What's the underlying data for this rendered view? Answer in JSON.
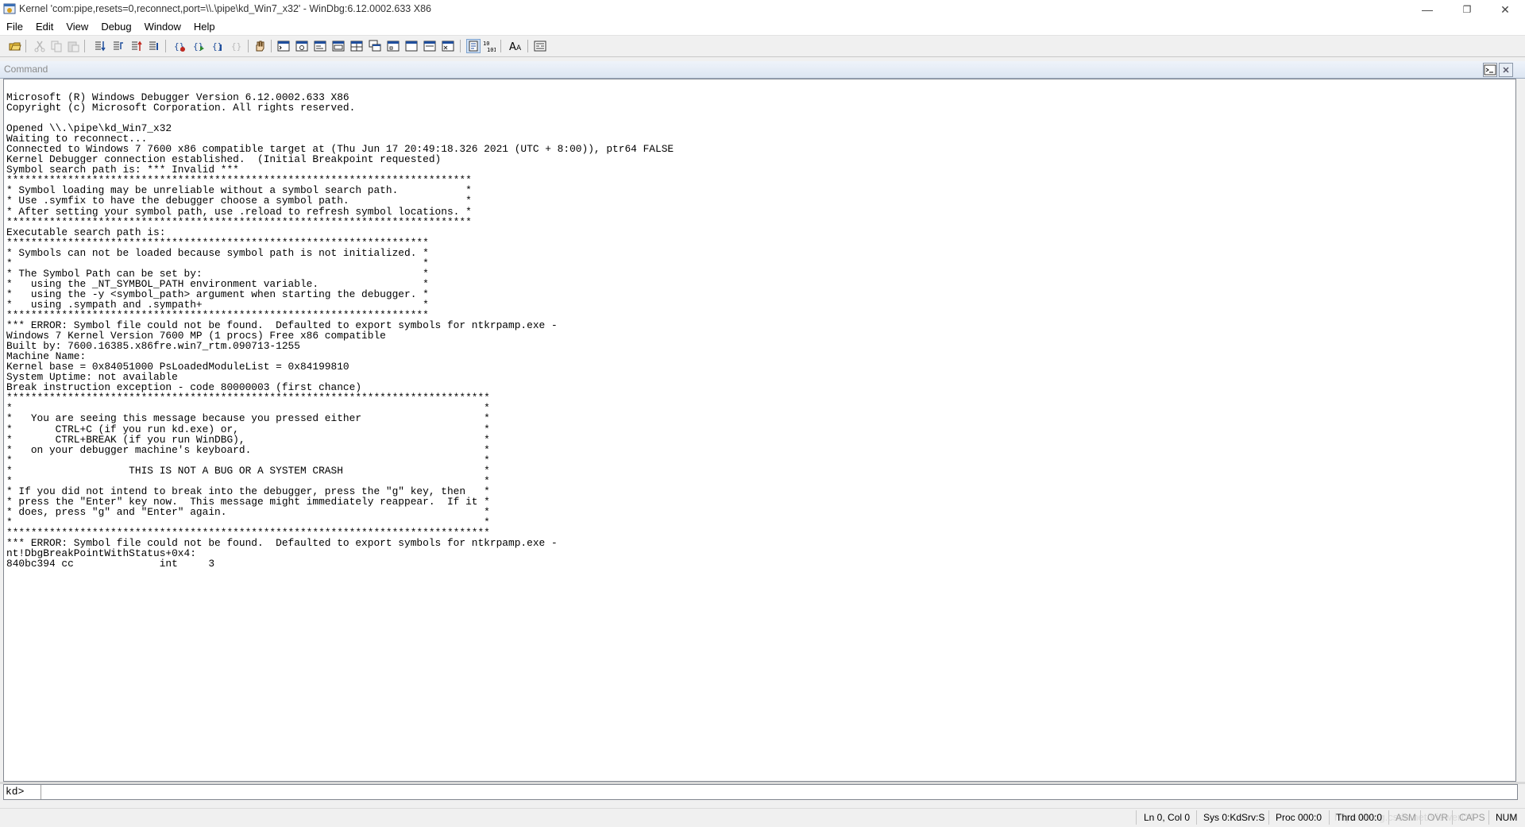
{
  "window": {
    "title": "Kernel 'com:pipe,resets=0,reconnect,port=\\\\.\\pipe\\kd_Win7_x32' - WinDbg:6.12.0002.633 X86",
    "controls": {
      "minimize": "—",
      "restore": "❐",
      "close": "✕"
    }
  },
  "menu": [
    "File",
    "Edit",
    "View",
    "Debug",
    "Window",
    "Help"
  ],
  "toolbar": {
    "icons": [
      "open-icon",
      "cut-icon",
      "copy-icon",
      "paste-icon",
      "step-into-icon",
      "step-over-icon",
      "step-out-icon",
      "run-to-cursor-icon",
      "toggle-breakpoint-icon",
      "go-icon",
      "break-icon",
      "restart-icon",
      "hand-icon",
      "command-window-icon",
      "watch-window-icon",
      "locals-window-icon",
      "registers-window-icon",
      "memory-window-icon",
      "call-stack-icon",
      "disassembly-icon",
      "scratch-pad-icon",
      "processes-threads-icon",
      "source-mode-icon",
      "hex-mode-icon",
      "font-icon",
      "options-icon"
    ]
  },
  "command_window": {
    "title": "Command",
    "output": "Microsoft (R) Windows Debugger Version 6.12.0002.633 X86\nCopyright (c) Microsoft Corporation. All rights reserved.\n\nOpened \\\\.\\pipe\\kd_Win7_x32\nWaiting to reconnect...\nConnected to Windows 7 7600 x86 compatible target at (Thu Jun 17 20:49:18.326 2021 (UTC + 8:00)), ptr64 FALSE\nKernel Debugger connection established.  (Initial Breakpoint requested)\nSymbol search path is: *** Invalid ***\n****************************************************************************\n* Symbol loading may be unreliable without a symbol search path.           *\n* Use .symfix to have the debugger choose a symbol path.                   *\n* After setting your symbol path, use .reload to refresh symbol locations. *\n****************************************************************************\nExecutable search path is:\n*********************************************************************\n* Symbols can not be loaded because symbol path is not initialized. *\n*                                                                   *\n* The Symbol Path can be set by:                                    *\n*   using the _NT_SYMBOL_PATH environment variable.                 *\n*   using the -y <symbol_path> argument when starting the debugger. *\n*   using .sympath and .sympath+                                    *\n*********************************************************************\n*** ERROR: Symbol file could not be found.  Defaulted to export symbols for ntkrpamp.exe -\nWindows 7 Kernel Version 7600 MP (1 procs) Free x86 compatible\nBuilt by: 7600.16385.x86fre.win7_rtm.090713-1255\nMachine Name:\nKernel base = 0x84051000 PsLoadedModuleList = 0x84199810\nSystem Uptime: not available\nBreak instruction exception - code 80000003 (first chance)\n*******************************************************************************\n*                                                                             *\n*   You are seeing this message because you pressed either                    *\n*       CTRL+C (if you run kd.exe) or,                                        *\n*       CTRL+BREAK (if you run WinDBG),                                       *\n*   on your debugger machine's keyboard.                                      *\n*                                                                             *\n*                   THIS IS NOT A BUG OR A SYSTEM CRASH                       *\n*                                                                             *\n* If you did not intend to break into the debugger, press the \"g\" key, then   *\n* press the \"Enter\" key now.  This message might immediately reappear.  If it *\n* does, press \"g\" and \"Enter\" again.                                          *\n*                                                                             *\n*******************************************************************************\n*** ERROR: Symbol file could not be found.  Defaulted to export symbols for ntkrpamp.exe -\nnt!DbgBreakPointWithStatus+0x4:\n840bc394 cc              int     3",
    "prompt": "kd>",
    "input_value": ""
  },
  "status_bar": {
    "watermark": "https://blog.csdn.net/ViewerD4",
    "ln_col": "Ln 0, Col 0",
    "sys": "Sys 0:KdSrv:S",
    "proc": "Proc 000:0",
    "thrd": "Thrd 000:0",
    "asm": "ASM",
    "ovr": "OVR",
    "caps": "CAPS",
    "num": "NUM"
  },
  "colors": {
    "icon_blue": "#1f4e9c",
    "icon_green": "#2c8a2c",
    "icon_red": "#c0281f",
    "header_grad": "#dde6f2"
  }
}
